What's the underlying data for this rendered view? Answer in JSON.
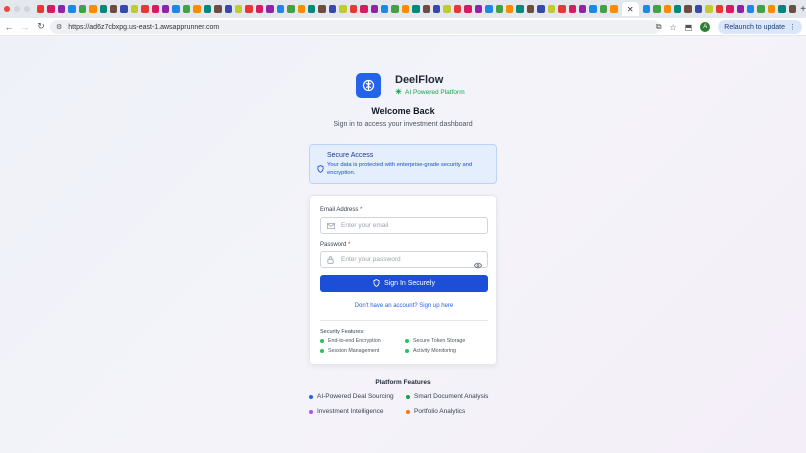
{
  "browser": {
    "url": "https://ad6z7cbxpg.us-east-1.awsapprunner.com",
    "relaunch_label": "Relaunch to update",
    "profile_initial": "A",
    "active_tab_close": "✕",
    "new_tab": "+"
  },
  "brand": {
    "name": "DeelFlow",
    "tagline": "AI Powered Platform",
    "accent": "#2563eb",
    "tagline_color": "#16a34a"
  },
  "welcome": {
    "title": "Welcome Back",
    "subtitle": "Sign in to access your investment dashboard"
  },
  "secure_notice": {
    "title": "Secure Access",
    "description": "Your data is protected with enterprise-grade security and encryption."
  },
  "form": {
    "email_label": "Email Address",
    "email_placeholder": "Enter your email",
    "password_label": "Password",
    "password_placeholder": "Enter your password",
    "required_mark": "*",
    "submit_label": "Sign In Securely",
    "signup_link": "Don't have an account? Sign up here"
  },
  "security_features": {
    "title": "Security Features:",
    "items": [
      {
        "label": "End-to-end Encryption",
        "color": "#22c55e"
      },
      {
        "label": "Secure Token Storage",
        "color": "#22c55e"
      },
      {
        "label": "Session Management",
        "color": "#22c55e"
      },
      {
        "label": "Activity Monitoring",
        "color": "#22c55e"
      }
    ]
  },
  "platform_features": {
    "title": "Platform Features",
    "items": [
      {
        "label": "AI-Powered Deal Sourcing",
        "color": "#2563eb"
      },
      {
        "label": "Smart Document Analysis",
        "color": "#16a34a"
      },
      {
        "label": "Investment Intelligence",
        "color": "#a855f7"
      },
      {
        "label": "Portfolio Analytics",
        "color": "#f97316"
      }
    ]
  }
}
